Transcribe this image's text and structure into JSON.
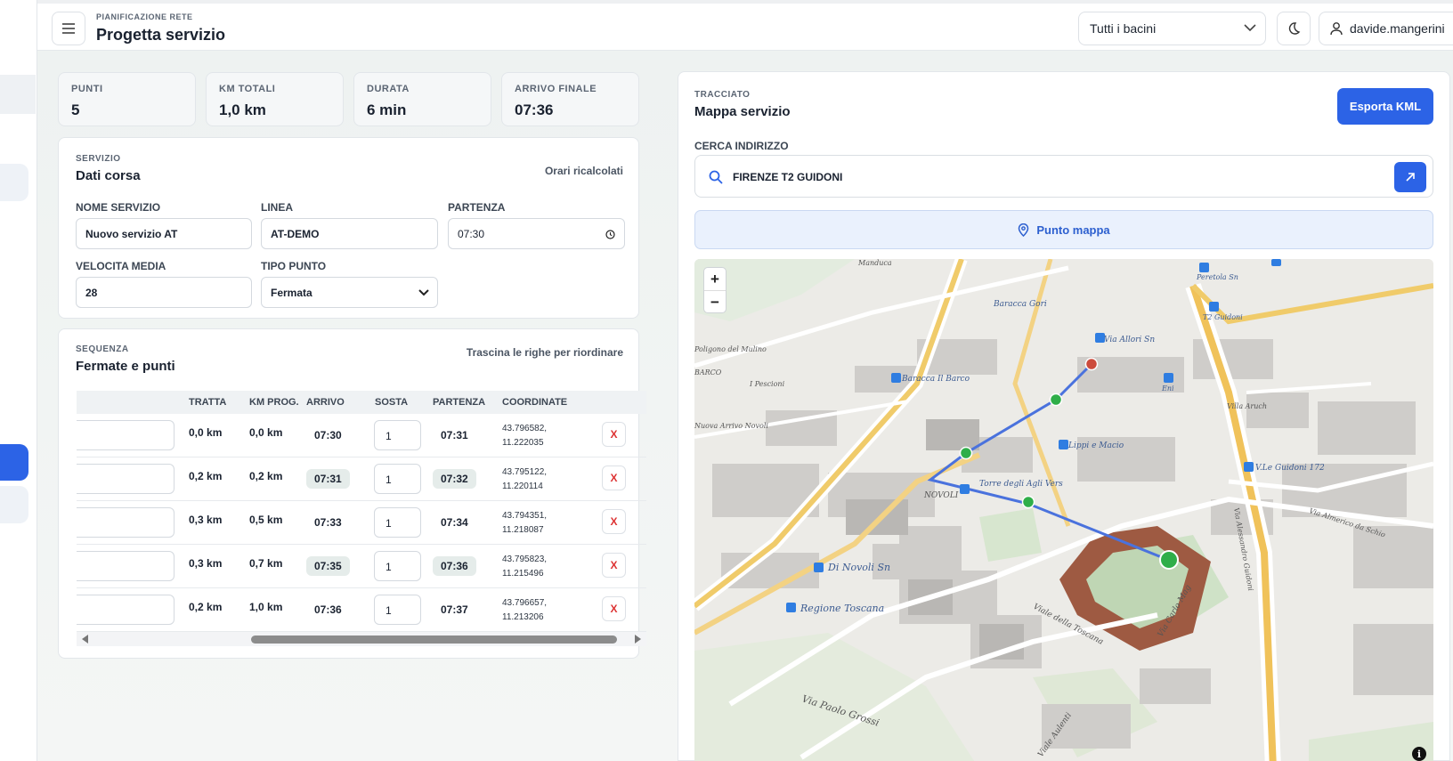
{
  "header": {
    "eyebrow": "PIANIFICAZIONE RETE",
    "title": "Progetta servizio",
    "basin_select": "Tutti i bacini",
    "user": "davide.mangerini"
  },
  "stats": [
    {
      "label": "PUNTI",
      "value": "5"
    },
    {
      "label": "KM TOTALI",
      "value": "1,0 km"
    },
    {
      "label": "DURATA",
      "value": "6 min"
    },
    {
      "label": "ARRIVO FINALE",
      "value": "07:36"
    }
  ],
  "service": {
    "eyebrow": "SERVIZIO",
    "title": "Dati corsa",
    "note": "Orari ricalcolati",
    "name_label": "NOME SERVIZIO",
    "name_value": "Nuovo servizio AT",
    "line_label": "LINEA",
    "line_value": "AT-DEMO",
    "departure_label": "PARTENZA",
    "departure_value": "07:30",
    "speed_label": "VELOCITA MEDIA",
    "speed_value": "28",
    "point_type_label": "TIPO PUNTO",
    "point_type_value": "Fermata"
  },
  "sequence": {
    "eyebrow": "SEQUENZA",
    "title": "Fermate e punti",
    "note": "Trascina le righe per riordinare",
    "columns": [
      "TRATTA",
      "KM PROG.",
      "ARRIVO",
      "SOSTA",
      "PARTENZA",
      "COORDINATE"
    ],
    "delete_label": "X",
    "rows": [
      {
        "tratta": "0,0 km",
        "km": "0,0 km",
        "arrivo": "07:30",
        "sosta": "1",
        "partenza": "07:31",
        "lat": "43.796582,",
        "lon": "11.222035"
      },
      {
        "tratta": "0,2 km",
        "km": "0,2 km",
        "arrivo": "07:31",
        "sosta": "1",
        "partenza": "07:32",
        "lat": "43.795122,",
        "lon": "11.220114"
      },
      {
        "tratta": "0,3 km",
        "km": "0,5 km",
        "arrivo": "07:33",
        "sosta": "1",
        "partenza": "07:34",
        "lat": "43.794351,",
        "lon": "11.218087"
      },
      {
        "tratta": "0,3 km",
        "km": "0,7 km",
        "arrivo": "07:35",
        "sosta": "1",
        "partenza": "07:36",
        "lat": "43.795823,",
        "lon": "11.215496"
      },
      {
        "tratta": "0,2 km",
        "km": "1,0 km",
        "arrivo": "07:36",
        "sosta": "1",
        "partenza": "07:37",
        "lat": "43.796657,",
        "lon": "11.213206"
      }
    ]
  },
  "map_panel": {
    "eyebrow": "TRACCIATO",
    "title": "Mappa servizio",
    "export_label": "Esporta KML",
    "search_label": "CERCA INDIRIZZO",
    "search_value": "FIRENZE T2 GUIDONI",
    "point_map_label": "Punto mappa",
    "zoom_in": "+",
    "zoom_out": "−",
    "labels": [
      "Manduca",
      "Peretola Sn",
      "Baracca Gori",
      "T2 Guidoni",
      "Via Allori Sn",
      "Poligono del Mulino",
      "BARCO",
      "I Pescioni",
      "Baracca Il Barco",
      "Eni",
      "Villa Aruch",
      "Nuova Arrivo Novoli",
      "Lippi e Macio",
      "V.Le Guidoni 172",
      "Torre degli Agli Vers",
      "NOVOLI",
      "Di Novoli Sn",
      "Regione Toscana",
      "Viale della Toscana",
      "Via Carlo Mag",
      "Via Paolo Grossi",
      "Via Alessandro Guidoni",
      "Via Almerico da Schio",
      "Viale Aulenti"
    ],
    "colors": {
      "route": "#4a72dd",
      "stop": "#2fae49",
      "start": "#cc4b3c",
      "accent": "#2c63e6"
    }
  }
}
